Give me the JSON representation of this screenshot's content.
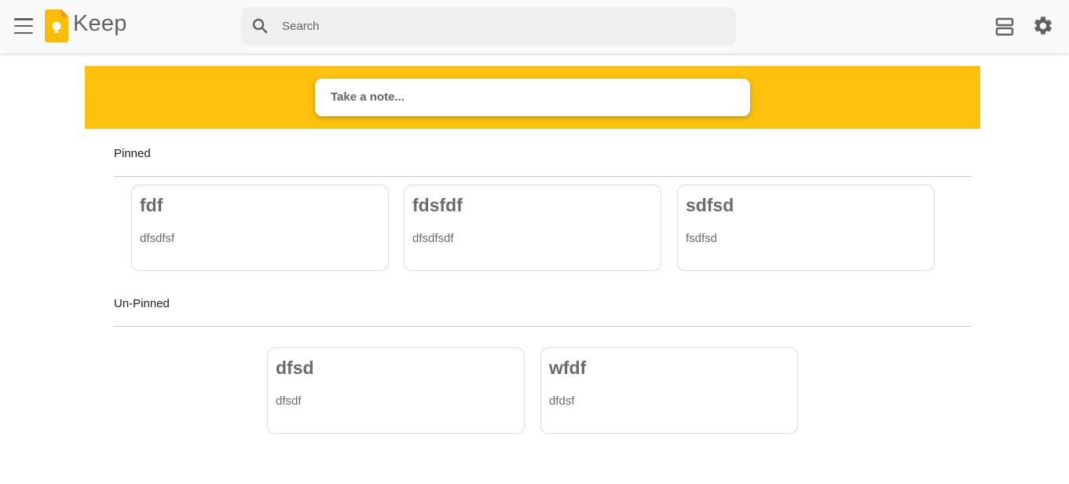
{
  "header": {
    "app_name": "Keep",
    "search": {
      "placeholder": "Search"
    }
  },
  "composer": {
    "placeholder": "Take a note..."
  },
  "pinned": {
    "title": "Pinned",
    "notes": [
      {
        "title": "fdf",
        "body": "dfsdfsf"
      },
      {
        "title": "fdsfdf",
        "body": "dfsdfsdf"
      },
      {
        "title": "sdfsd",
        "body": "fsdfsd"
      }
    ]
  },
  "unpinned": {
    "title": "Un-Pinned",
    "notes": [
      {
        "title": "dfsd",
        "body": "dfsdf"
      },
      {
        "title": "wfdf",
        "body": "dfdsf"
      }
    ]
  },
  "colors": {
    "accent": "#fdc00c",
    "header_bg": "#f8f9fa",
    "search_bg": "#efeff1"
  },
  "icons": [
    "menu-icon",
    "keep-logo-icon",
    "search-icon",
    "list-view-icon",
    "settings-icon"
  ]
}
